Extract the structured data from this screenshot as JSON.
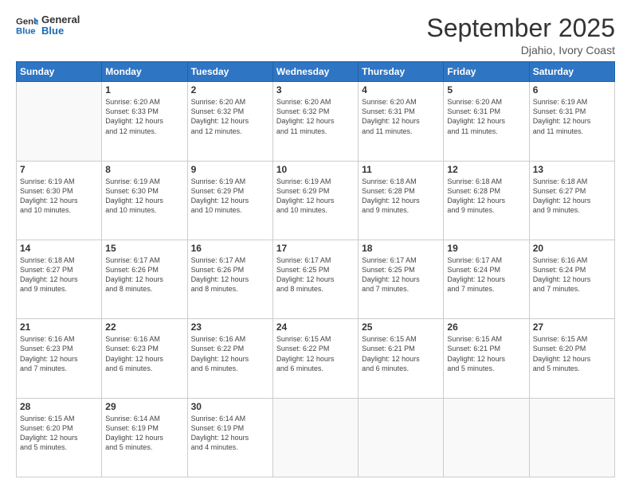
{
  "logo": {
    "line1": "General",
    "line2": "Blue"
  },
  "title": "September 2025",
  "subtitle": "Djahio, Ivory Coast",
  "days_header": [
    "Sunday",
    "Monday",
    "Tuesday",
    "Wednesday",
    "Thursday",
    "Friday",
    "Saturday"
  ],
  "weeks": [
    [
      {
        "num": "",
        "info": ""
      },
      {
        "num": "1",
        "info": "Sunrise: 6:20 AM\nSunset: 6:33 PM\nDaylight: 12 hours\nand 12 minutes."
      },
      {
        "num": "2",
        "info": "Sunrise: 6:20 AM\nSunset: 6:32 PM\nDaylight: 12 hours\nand 12 minutes."
      },
      {
        "num": "3",
        "info": "Sunrise: 6:20 AM\nSunset: 6:32 PM\nDaylight: 12 hours\nand 11 minutes."
      },
      {
        "num": "4",
        "info": "Sunrise: 6:20 AM\nSunset: 6:31 PM\nDaylight: 12 hours\nand 11 minutes."
      },
      {
        "num": "5",
        "info": "Sunrise: 6:20 AM\nSunset: 6:31 PM\nDaylight: 12 hours\nand 11 minutes."
      },
      {
        "num": "6",
        "info": "Sunrise: 6:19 AM\nSunset: 6:31 PM\nDaylight: 12 hours\nand 11 minutes."
      }
    ],
    [
      {
        "num": "7",
        "info": "Sunrise: 6:19 AM\nSunset: 6:30 PM\nDaylight: 12 hours\nand 10 minutes."
      },
      {
        "num": "8",
        "info": "Sunrise: 6:19 AM\nSunset: 6:30 PM\nDaylight: 12 hours\nand 10 minutes."
      },
      {
        "num": "9",
        "info": "Sunrise: 6:19 AM\nSunset: 6:29 PM\nDaylight: 12 hours\nand 10 minutes."
      },
      {
        "num": "10",
        "info": "Sunrise: 6:19 AM\nSunset: 6:29 PM\nDaylight: 12 hours\nand 10 minutes."
      },
      {
        "num": "11",
        "info": "Sunrise: 6:18 AM\nSunset: 6:28 PM\nDaylight: 12 hours\nand 9 minutes."
      },
      {
        "num": "12",
        "info": "Sunrise: 6:18 AM\nSunset: 6:28 PM\nDaylight: 12 hours\nand 9 minutes."
      },
      {
        "num": "13",
        "info": "Sunrise: 6:18 AM\nSunset: 6:27 PM\nDaylight: 12 hours\nand 9 minutes."
      }
    ],
    [
      {
        "num": "14",
        "info": "Sunrise: 6:18 AM\nSunset: 6:27 PM\nDaylight: 12 hours\nand 9 minutes."
      },
      {
        "num": "15",
        "info": "Sunrise: 6:17 AM\nSunset: 6:26 PM\nDaylight: 12 hours\nand 8 minutes."
      },
      {
        "num": "16",
        "info": "Sunrise: 6:17 AM\nSunset: 6:26 PM\nDaylight: 12 hours\nand 8 minutes."
      },
      {
        "num": "17",
        "info": "Sunrise: 6:17 AM\nSunset: 6:25 PM\nDaylight: 12 hours\nand 8 minutes."
      },
      {
        "num": "18",
        "info": "Sunrise: 6:17 AM\nSunset: 6:25 PM\nDaylight: 12 hours\nand 7 minutes."
      },
      {
        "num": "19",
        "info": "Sunrise: 6:17 AM\nSunset: 6:24 PM\nDaylight: 12 hours\nand 7 minutes."
      },
      {
        "num": "20",
        "info": "Sunrise: 6:16 AM\nSunset: 6:24 PM\nDaylight: 12 hours\nand 7 minutes."
      }
    ],
    [
      {
        "num": "21",
        "info": "Sunrise: 6:16 AM\nSunset: 6:23 PM\nDaylight: 12 hours\nand 7 minutes."
      },
      {
        "num": "22",
        "info": "Sunrise: 6:16 AM\nSunset: 6:23 PM\nDaylight: 12 hours\nand 6 minutes."
      },
      {
        "num": "23",
        "info": "Sunrise: 6:16 AM\nSunset: 6:22 PM\nDaylight: 12 hours\nand 6 minutes."
      },
      {
        "num": "24",
        "info": "Sunrise: 6:15 AM\nSunset: 6:22 PM\nDaylight: 12 hours\nand 6 minutes."
      },
      {
        "num": "25",
        "info": "Sunrise: 6:15 AM\nSunset: 6:21 PM\nDaylight: 12 hours\nand 6 minutes."
      },
      {
        "num": "26",
        "info": "Sunrise: 6:15 AM\nSunset: 6:21 PM\nDaylight: 12 hours\nand 5 minutes."
      },
      {
        "num": "27",
        "info": "Sunrise: 6:15 AM\nSunset: 6:20 PM\nDaylight: 12 hours\nand 5 minutes."
      }
    ],
    [
      {
        "num": "28",
        "info": "Sunrise: 6:15 AM\nSunset: 6:20 PM\nDaylight: 12 hours\nand 5 minutes."
      },
      {
        "num": "29",
        "info": "Sunrise: 6:14 AM\nSunset: 6:19 PM\nDaylight: 12 hours\nand 5 minutes."
      },
      {
        "num": "30",
        "info": "Sunrise: 6:14 AM\nSunset: 6:19 PM\nDaylight: 12 hours\nand 4 minutes."
      },
      {
        "num": "",
        "info": ""
      },
      {
        "num": "",
        "info": ""
      },
      {
        "num": "",
        "info": ""
      },
      {
        "num": "",
        "info": ""
      }
    ]
  ]
}
